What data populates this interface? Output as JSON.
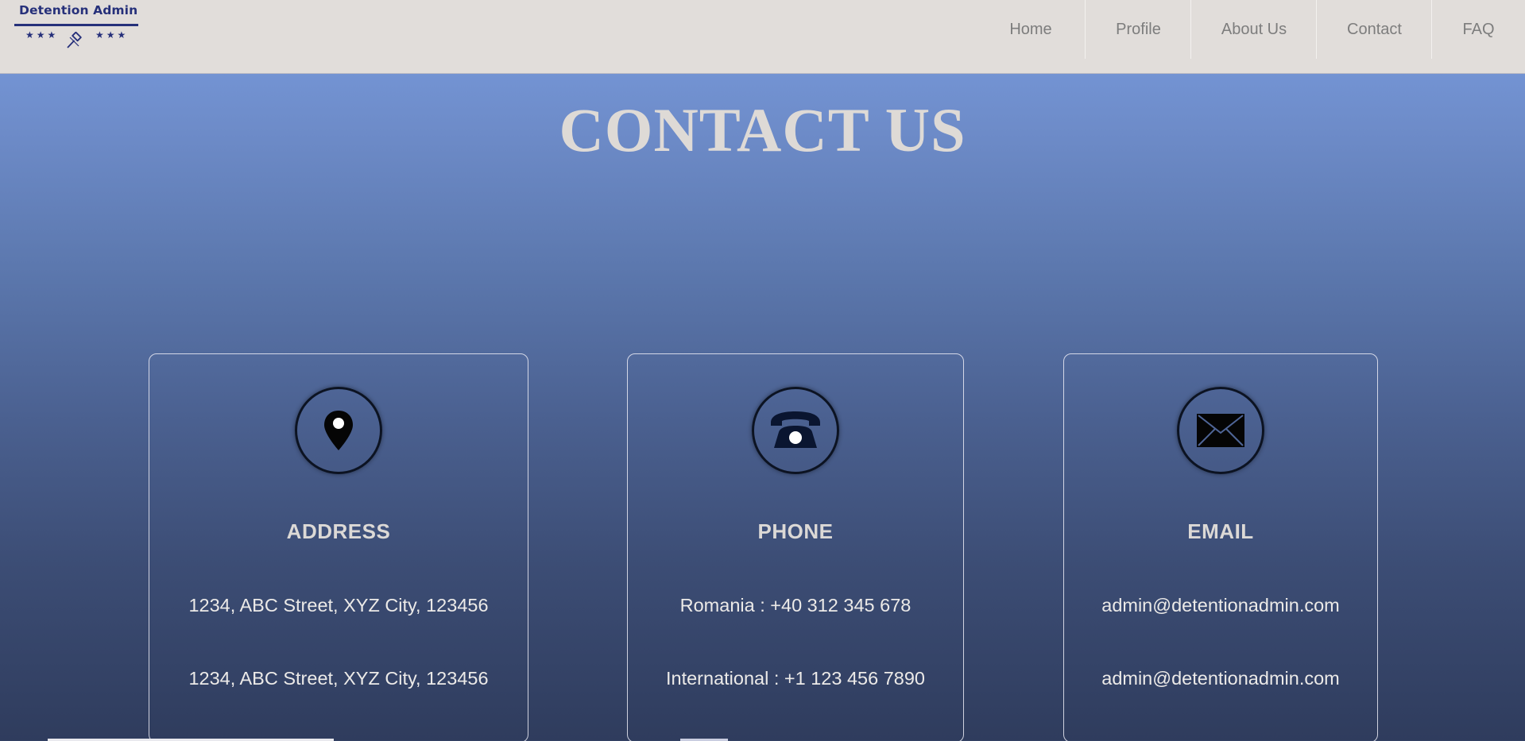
{
  "brand": {
    "name": "Detention Admin",
    "logo_stars_left": "★★★",
    "logo_stars_right": "★★★",
    "logo_icon": "gavel-icon",
    "color": "#26307a"
  },
  "nav": {
    "items": [
      {
        "label": "Home"
      },
      {
        "label": "Profile"
      },
      {
        "label": "About Us"
      },
      {
        "label": "Contact"
      },
      {
        "label": "FAQ"
      }
    ]
  },
  "page": {
    "title": "CONTACT US"
  },
  "cards": {
    "address": {
      "icon": "map-pin-icon",
      "heading": "ADDRESS",
      "line1": "1234, ABC Street, XYZ City, 123456",
      "line2": "1234, ABC Street, XYZ City, 123456"
    },
    "phone": {
      "icon": "telephone-icon",
      "heading": "PHONE",
      "line1": "Romania : +40 312 345 678",
      "line2": "International : +1 123 456 7890"
    },
    "email": {
      "icon": "envelope-icon",
      "heading": "EMAIL",
      "line1": "admin@detentionadmin.com",
      "line2": "admin@detentionadmin.com"
    }
  },
  "colors": {
    "header_bg": "#e1ddda",
    "nav_text": "#7d7d7d",
    "title_text": "#dedad6",
    "bg_top": "#7a9de0",
    "bg_bottom": "#2f3c5d"
  }
}
